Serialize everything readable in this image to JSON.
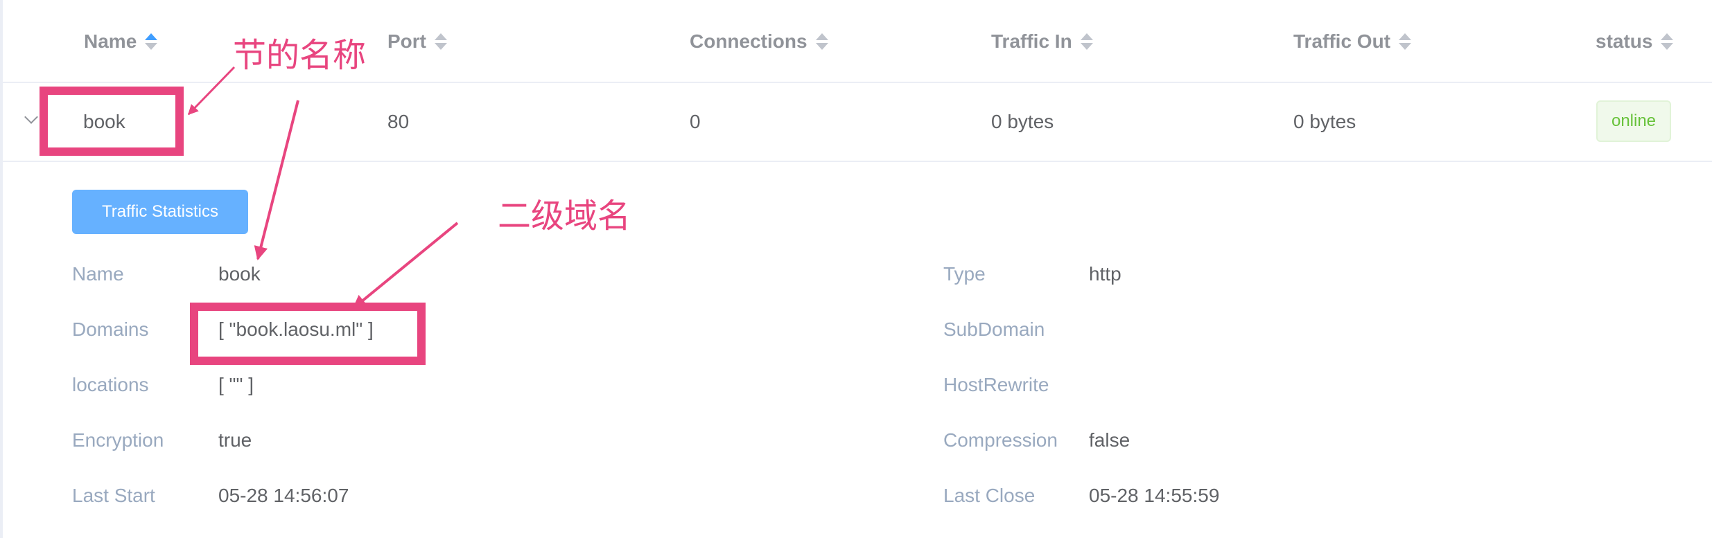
{
  "table": {
    "columns": {
      "name": "Name",
      "port": "Port",
      "connections": "Connections",
      "traffic_in": "Traffic In",
      "traffic_out": "Traffic Out",
      "status": "status"
    },
    "sorted_column": "name",
    "row": {
      "name": "book",
      "port": "80",
      "connections": "0",
      "traffic_in": "0 bytes",
      "traffic_out": "0 bytes",
      "status": "online"
    }
  },
  "detail": {
    "button_label": "Traffic Statistics",
    "left": [
      {
        "label": "Name",
        "value": "book"
      },
      {
        "label": "Domains",
        "value": "[ \"book.laosu.ml\" ]"
      },
      {
        "label": "locations",
        "value": "[ \"\" ]"
      },
      {
        "label": "Encryption",
        "value": "true"
      },
      {
        "label": "Last Start",
        "value": "05-28 14:56:07"
      }
    ],
    "right": [
      {
        "label": "Type",
        "value": "http"
      },
      {
        "label": "SubDomain",
        "value": ""
      },
      {
        "label": "HostRewrite",
        "value": ""
      },
      {
        "label": "Compression",
        "value": "false"
      },
      {
        "label": "Last Close",
        "value": "05-28 14:55:59"
      }
    ]
  },
  "annotations": {
    "name_note": "节的名称",
    "subdomain_note": "二级域名"
  },
  "colors": {
    "accent": "#409eff",
    "button": "#66b1ff",
    "annotation": "#e8457f",
    "online_text": "#67c23a",
    "online_bg": "#f0f9eb"
  }
}
